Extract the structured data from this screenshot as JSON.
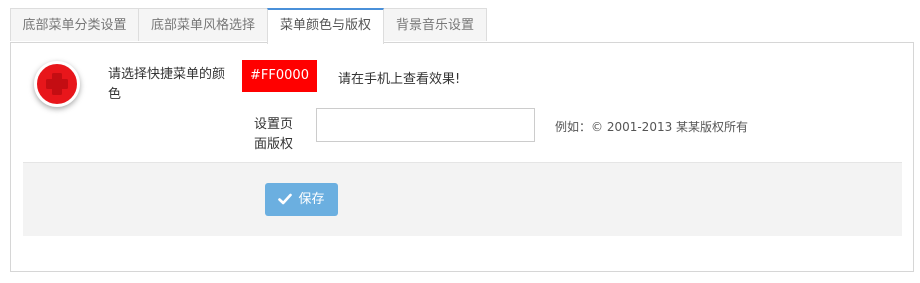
{
  "tabs": [
    {
      "label": "底部菜单分类设置",
      "active": false
    },
    {
      "label": "底部菜单风格选择",
      "active": false
    },
    {
      "label": "菜单颜色与版权",
      "active": true
    },
    {
      "label": "背景音乐设置",
      "active": false
    }
  ],
  "form": {
    "color_label": "请选择快捷菜单的颜色",
    "color_value": "#FF0000",
    "preview_hint": "请在手机上查看效果!",
    "copyright_label": "设置页面版权",
    "copyright_value": "",
    "copyright_example": "例如：© 2001-2013 某某版权所有",
    "save_label": "保存"
  },
  "icons": {
    "logo": "plus-circle-icon",
    "save": "check-icon"
  },
  "colors": {
    "accent": "#ff0000",
    "save_button": "#6bafe0",
    "active_tab_border": "#4a90d9"
  }
}
